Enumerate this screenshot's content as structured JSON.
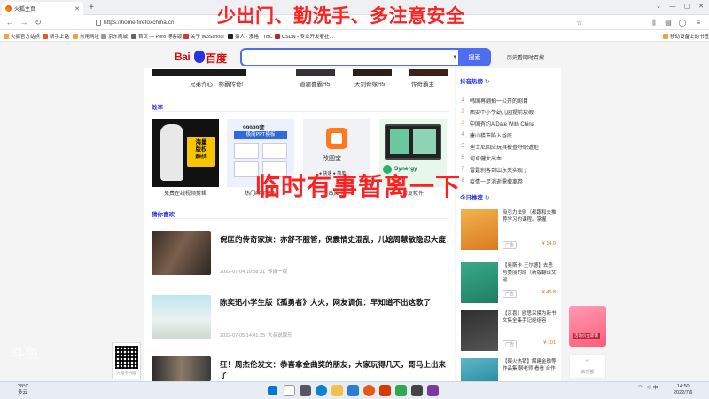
{
  "browser": {
    "tab_title": "火狐主页",
    "url": "https://home.firefoxchina.cn",
    "bookmarks": [
      "火狐官方站点",
      "新手上路",
      "常用网址",
      "京东商城",
      "首页 — Poro 博客版",
      "关于 W3School",
      "猫人 · 漫格 · TBC",
      "CSDN - 专业开发者社...",
      "移动设备上的书签"
    ]
  },
  "overlay": {
    "top_banner": "少出门、勤洗手、多注意安全",
    "center_banner": "临时有事暂离一下",
    "watermark": "斗鱼"
  },
  "baidu": {
    "logo_text_left": "Bai",
    "logo_text_right": "百度",
    "search_button": "搜索",
    "settings_link": "历史看网时百搜"
  },
  "strip_labels": [
    "兄弟齐心，称霸传奇!",
    "道题喜霸H5",
    "天剑奇缘H5",
    "传奇霸主"
  ],
  "sections": {
    "efficiency": "效率",
    "guess": "猜你喜欢",
    "hot_title": "抖音热榜",
    "recommend": "今日推荐"
  },
  "cards": [
    {
      "label": "免费在线视频剪辑",
      "overlay": "海量\n版权\n素材库"
    },
    {
      "label": "热门PPT模板",
      "overlay": "99999套\n极简PPT模板"
    },
    {
      "label": "改图宝",
      "overlay": "改图宝"
    },
    {
      "label": "修复软件",
      "overlay": "Synergy"
    }
  ],
  "news": [
    {
      "title": "倪匡的传奇家族：亦舒不服管，倪震情史混乱，儿媳周慧敏隐忍大度",
      "time": "2022-07-04 19:58:31",
      "source": "传媒一视"
    },
    {
      "title": "陈奕迅小学生版《孤勇者》大火，网友调侃：早知道不出这歌了",
      "time": "2022-07-05 14:41:25",
      "source": "大叔说娱乐"
    },
    {
      "title": "狂！周杰伦发文：恭喜拿金曲奖的朋友，大家玩得几天，哥马上出来了",
      "time": "",
      "source": ""
    }
  ],
  "hot_list": [
    "韩国再翻拍一公开的剧目",
    "西安中小学幼儿园提前放假",
    "中国有约A Date With China",
    "唐山楼市陷入谷底",
    "迪士尼回应玩具被查夺职遭拒",
    "何卓健大出血",
    "雷霆刹客到山东关实现了",
    "疫情一足消逝需撤离卷"
  ],
  "books": [
    {
      "text": "吸引力法则（都跟和夫推荐学习的课程。掌握",
      "tag": "广告",
      "price": "¥ 14.9"
    },
    {
      "text": "【奥斯卡·王尔德】去恶与美丽的原（新版翻译文版",
      "tag": "广告",
      "price": "¥ 46.8"
    },
    {
      "text": "【京喜】欧思采摸为新书文集全集手记经组容",
      "tag": "广告",
      "price": "¥ 101"
    },
    {
      "text": "【曝火热销】解建金融等作品集 聊老师 看看 合作",
      "tag": "",
      "price": ""
    }
  ],
  "qr_caption": "火狐手机版",
  "ad_text": "活动价立即领",
  "back_top": "去顶部",
  "taskbar": {
    "weather_temp": "28°C",
    "weather_desc": "多云",
    "tray_lang": "中",
    "time": "14:50",
    "date": "2022/7/6"
  }
}
